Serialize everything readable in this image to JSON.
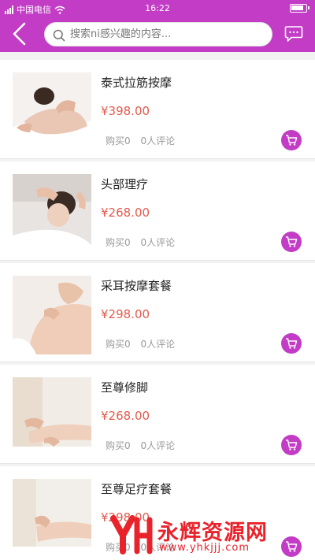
{
  "status_bar": {
    "carrier": "中国电信",
    "time": "16:22",
    "carrier_icon": "hd-signal-icon"
  },
  "header": {
    "back_icon": "chevron-left-icon",
    "search_placeholder": "搜索ni感兴趣的内容...",
    "message_icon": "chat-bubble-icon",
    "background_color": "#c23cc6"
  },
  "products": [
    {
      "name": "泰式拉筋按摩",
      "price": "¥398.00",
      "sold": "购买0",
      "reviews": "0人评论",
      "image": "massage-back-photo"
    },
    {
      "name": "头部理疗",
      "price": "¥268.00",
      "sold": "购买0",
      "reviews": "0人评论",
      "image": "head-therapy-photo"
    },
    {
      "name": "采耳按摩套餐",
      "price": "¥298.00",
      "sold": "购买0",
      "reviews": "0人评论",
      "image": "shoulder-massage-photo"
    },
    {
      "name": "至尊修脚",
      "price": "¥268.00",
      "sold": "购买0",
      "reviews": "0人评论",
      "image": "foot-care-photo"
    },
    {
      "name": "至尊足疗套餐",
      "price": "¥298.00",
      "sold": "购买0",
      "reviews": "0人评论",
      "image": "foot-massage-photo"
    }
  ],
  "watermark": {
    "title": "永辉资源网",
    "url": "www.yhkjjj.com",
    "logo": "yh-logo"
  },
  "colors": {
    "accent": "#c23cc6",
    "price": "#e35a4c"
  }
}
